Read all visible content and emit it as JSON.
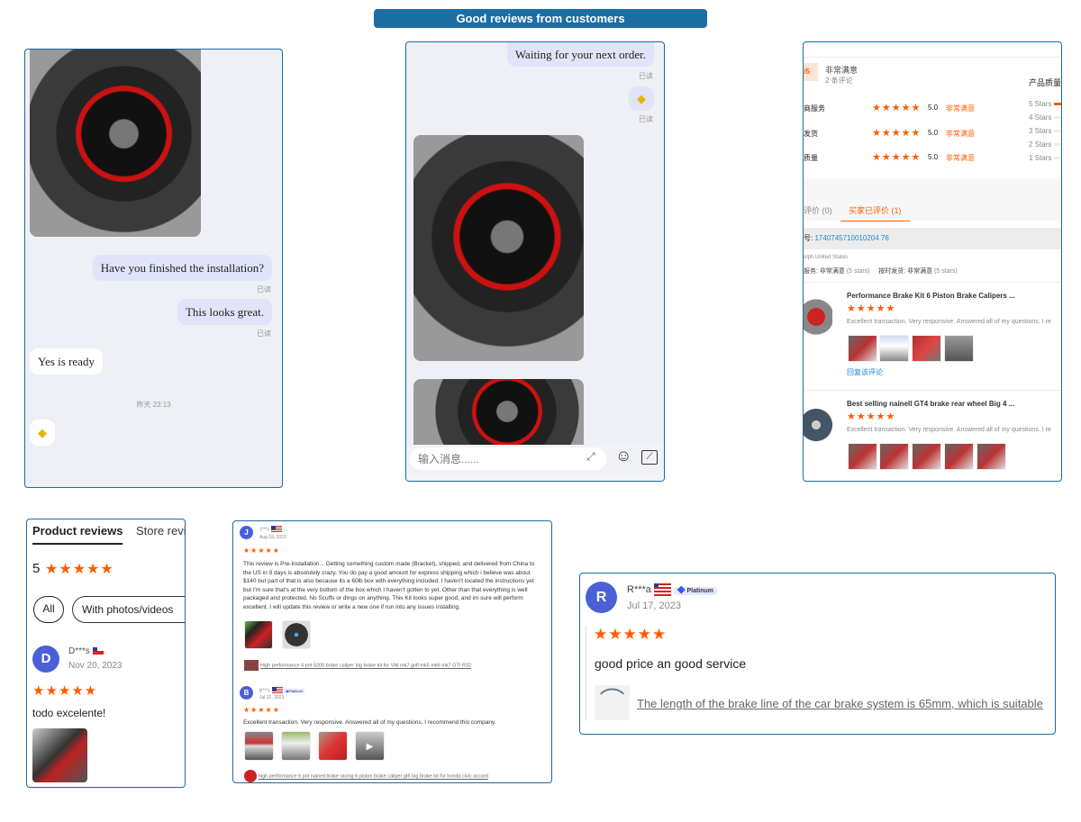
{
  "banner": "Good reviews from customers",
  "chat1": {
    "m1": "Have you finished the installation?",
    "m2": "This looks great.",
    "m3": "Yes is ready",
    "read": "已读",
    "time": "昨天 23:13"
  },
  "chat2": {
    "m1": "Waiting for your next order.",
    "read": "已读",
    "placeholder": "输入消息......"
  },
  "store": {
    "score": "0/5",
    "level": "非常满意",
    "count": "2 条评论",
    "rows": [
      {
        "label": "商服务",
        "score": "5.0",
        "level": "非常满意"
      },
      {
        "label": "发货",
        "score": "5.0",
        "level": "非常满意"
      },
      {
        "label": "质量",
        "score": "5.0",
        "level": "非常满意"
      }
    ],
    "quality_title": "产品质量",
    "bars": [
      "5 Stars",
      "4 Stars",
      "3 Stars",
      "2 Stars",
      "1 Stars"
    ],
    "tab1": "评价 (0)",
    "tab2": "买家已评价 (1)",
    "order_label": "号:",
    "order": "1740745710010204 76",
    "location": "olph,United States",
    "service": "服务: 非常满意",
    "service_stars": "(5 stars)",
    "ship": "按时发货: 非常满意",
    "ship_stars": "(5 stars)",
    "items": [
      {
        "title": "Performance Brake Kit 6 Piston Brake Calipers ...",
        "text": "Excellent transaction. Very responsive. Answered all of my questions. I re",
        "reply": "回复该评论"
      },
      {
        "title": "Best selling nainell GT4 brake rear wheel Big 4 ...",
        "text": "Excellent transaction. Very responsive. Answered all of my questions. I re"
      }
    ]
  },
  "reviews1": {
    "tab1": "Product reviews",
    "tab2": "Store revi",
    "rating": "5",
    "filter_all": "All",
    "filter_photos": "With photos/videos",
    "user": "D***s",
    "date": "Nov 20, 2023",
    "text": "todo excelente!"
  },
  "reviews2": {
    "r1": {
      "initial": "J",
      "user": "J***n",
      "date": "Aug 18, 2023",
      "text": "This review is Pre-Installation... Getting something custom made (Bracket), shipped, and delivered from China to the US in 9 days is absolutely crazy. You do pay a good amount for express shipping which i believe was about $140 but part of that is also because its a 60lb box with everything included. I haven't located the instructions yet but I'm sure that's at the very bottom of the box which I haven't gotten to yet. Other than that everything is well packaged and protected. No Scuffs or dings on anything. This Kit looks super good, and im sure will perform excellent. I will update this review or write a new one if run into any issues installing.",
      "product": "High performance 4 pot 5200 brake caliper big brake kit for VW mk7 golf mk5 mk6 mk7 GTI R32"
    },
    "r2": {
      "initial": "B",
      "user": "B***s",
      "badge": "Platinum",
      "date": "Jul 22, 2023",
      "text": "Excellent transaction. Very responsive. Answered all of my questions. I recommend this company.",
      "product": "high performance 6 pot nainell brake racing 6 piston brake caliper gt6 big brake kit for honda civic accord"
    }
  },
  "reviews3": {
    "initial": "R",
    "user": "R***a",
    "badge": "Platinum",
    "date": "Jul 17, 2023",
    "text": "good price an good service",
    "product": "The length of the brake line of the car brake system is 65mm, which is suitable"
  },
  "stars": "★★★★★",
  "colors": {
    "accent": "#ff5a00",
    "frame": "#1c6aa0",
    "avatar": "#4b5fd6"
  }
}
